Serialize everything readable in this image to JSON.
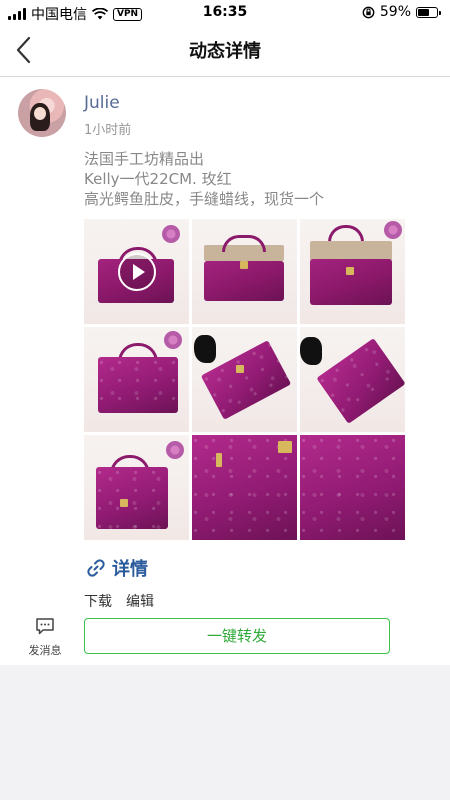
{
  "status_bar": {
    "carrier": "中国电信",
    "vpn": "VPN",
    "time": "16:35",
    "battery_percent": "59%",
    "battery_level": 0.59
  },
  "nav": {
    "title": "动态详情",
    "back_icon": "chevron-left-icon"
  },
  "post": {
    "username": "Julie",
    "timestamp": "1小时前",
    "text_lines": [
      "法国手工坊精品出",
      "Kelly一代22CM. 玫红",
      "高光鳄鱼肚皮，手缝蜡线，现货一个"
    ],
    "image_count": 9,
    "first_is_video": true
  },
  "actions": {
    "details_label": "详情",
    "details_icon": "link-icon",
    "download_label": "下载",
    "edit_label": "编辑",
    "message_label": "发消息",
    "message_icon": "chat-icon",
    "forward_label": "一键转发"
  },
  "colors": {
    "username": "#576b95",
    "details": "#2a5b9c",
    "forward_border": "#3ec24a",
    "forward_text": "#2faa3a",
    "bag": "#9a1f78"
  }
}
